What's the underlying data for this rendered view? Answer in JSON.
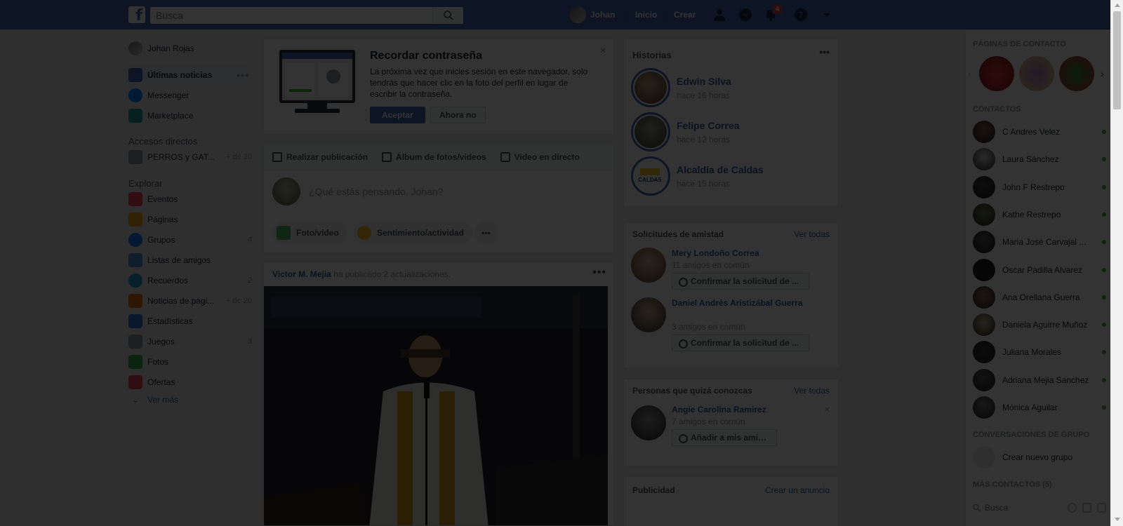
{
  "topbar": {
    "logo": "f",
    "search_placeholder": "Busca",
    "user_name": "Johan",
    "nav_home": "Inicio",
    "nav_create": "Crear",
    "notif_count": "4"
  },
  "left_nav": {
    "profile_name": "Johan Rojas",
    "main_items": [
      {
        "label": "Últimas noticias",
        "icon": "news-feed-icon"
      },
      {
        "label": "Messenger",
        "icon": "messenger-icon"
      },
      {
        "label": "Marketplace",
        "icon": "marketplace-icon"
      }
    ],
    "shortcuts_title": "Accesos directos",
    "shortcuts": [
      {
        "label": "PERROS y GAT...",
        "count": "+ de 20"
      }
    ],
    "explore_title": "Explorar",
    "explore": [
      {
        "label": "Eventos",
        "count": ""
      },
      {
        "label": "Páginas",
        "count": ""
      },
      {
        "label": "Grupos",
        "count": "4"
      },
      {
        "label": "Listas de amigos",
        "count": ""
      },
      {
        "label": "Recuerdos",
        "count": "2"
      },
      {
        "label": "Noticias de pági...",
        "count": "+ de 20"
      },
      {
        "label": "Estadísticas",
        "count": ""
      },
      {
        "label": "Juegos",
        "count": "3"
      },
      {
        "label": "Fotos",
        "count": ""
      },
      {
        "label": "Ofertas",
        "count": ""
      }
    ],
    "see_more": "Ver más"
  },
  "remember": {
    "title": "Recordar contraseña",
    "text": "La próxima vez que inicies sesión en este navegador, solo tendrás que hacer clic en la foto del perfil en lugar de escribir la contraseña.",
    "accept": "Aceptar",
    "not_now": "Ahora no",
    "close": "×"
  },
  "composer": {
    "tab_post": "Realizar publicación",
    "tab_album": "Álbum de fotos/videos",
    "tab_live": "Video en directo",
    "placeholder": "¿Qué estás pensando, Johan?",
    "photo_video": "Foto/video",
    "feeling": "Sentimiento/actividad",
    "more": "•••"
  },
  "post": {
    "author": "Victor M. Mejia",
    "action": "ha publicado 2 actualizaciones.",
    "more": "•••"
  },
  "stories": {
    "title": "Historias",
    "more": "•••",
    "items": [
      {
        "name": "Edwin Silva",
        "time": "hace 16 horas"
      },
      {
        "name": "Felipe Correa",
        "time": "hace 12 horas"
      },
      {
        "name": "Alcaldía de Caldas",
        "time": "hace 15 horas",
        "logo_text": "CALDAS"
      }
    ]
  },
  "friend_requests": {
    "title": "Solicitudes de amistad",
    "see_all": "Ver todas",
    "items": [
      {
        "name": "Mery Londoño Correa",
        "mutual": "11 amigos en común",
        "button": "Confirmar la solicitud de ..."
      },
      {
        "name": "Daniel Andrés Aristizábal Guerra",
        "mutual": "3 amigos en común",
        "button": "Confirmar la solicitud de ..."
      }
    ]
  },
  "people_you_may_know": {
    "title": "Personas que quizá conozcas",
    "see_all": "Ver todas",
    "items": [
      {
        "name": "Angie Carolina Ramirez",
        "mutual": "7 amigos en común",
        "button": "Añadir a mis amigos",
        "close": "×"
      }
    ]
  },
  "ads": {
    "title": "Publicidad",
    "create": "Crear un anuncio"
  },
  "chat": {
    "pages_title": "PÁGINAS DE CONTACTO",
    "contacts_title": "CONTACTOS",
    "contacts": [
      "C Andres Velez",
      "Laura Sánchez",
      "John F Restrepo",
      "Kathe Restrepo",
      "Maria José Carvajal ...",
      "Oscar Padilla Alvarez",
      "Ana Orellana Guerra",
      "Daniela Aguirre Muñoz",
      "Juliana Morales",
      "Adriana Mejia Sanchez",
      "Mónica Aguilar"
    ],
    "group_title": "CONVERSACIONES DE GRUPO",
    "new_group": "Crear nuevo grupo",
    "more_title": "MÁS CONTACTOS (5)",
    "search_placeholder": "Busca"
  },
  "colors": {
    "brand": "#4267b2",
    "link": "#365899",
    "online": "#42b72a",
    "badge": "#fa3e3e"
  }
}
